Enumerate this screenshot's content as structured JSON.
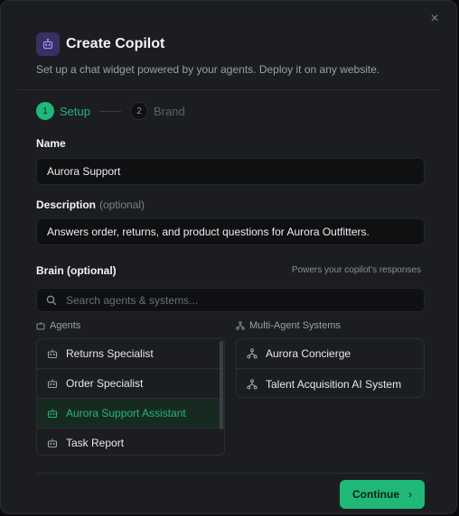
{
  "dialog": {
    "title": "Create Copilot",
    "subtitle": "Set up a chat widget powered by your agents. Deploy it on any website.",
    "close_icon": "×"
  },
  "steps": [
    {
      "number": "1",
      "label": "Setup",
      "state": "active"
    },
    {
      "number": "2",
      "label": "Brand",
      "state": "inactive"
    }
  ],
  "name_field": {
    "label": "Name",
    "value": "Aurora Support"
  },
  "description_field": {
    "label": "Description",
    "optional": "(optional)",
    "value": "Answers order, returns, and product questions for Aurora Outfitters."
  },
  "brain": {
    "label": "Brain (optional)",
    "hint": "Powers your copilot's responses",
    "search_placeholder": "Search agents & systems...",
    "agents_heading": "Agents",
    "systems_heading": "Multi-Agent Systems",
    "agents": [
      {
        "label": "Returns Specialist",
        "selected": false
      },
      {
        "label": "Order Specialist",
        "selected": false
      },
      {
        "label": "Aurora Support Assistant",
        "selected": true
      },
      {
        "label": "Task Report",
        "selected": false
      }
    ],
    "systems": [
      {
        "label": "Aurora Concierge"
      },
      {
        "label": "Talent Acquisition AI System"
      }
    ]
  },
  "footer": {
    "continue_label": "Continue",
    "chevron": "›"
  },
  "colors": {
    "accent": "#21b67a",
    "background": "#1b1d21",
    "input_bg": "#0f1012",
    "logo_bg": "#3a2f63"
  }
}
